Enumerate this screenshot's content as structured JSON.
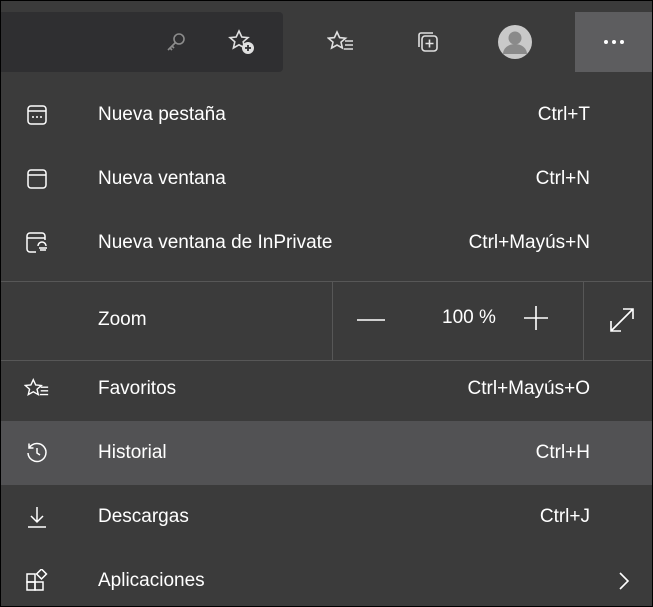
{
  "toolbar": {
    "icons": [
      "key-icon",
      "add-favorite-icon",
      "favorites-icon",
      "collections-icon",
      "profile-avatar",
      "more-icon"
    ]
  },
  "menu": {
    "items": [
      {
        "label": "Nueva pestaña",
        "shortcut": "Ctrl+T",
        "icon": "new-tab-icon"
      },
      {
        "label": "Nueva ventana",
        "shortcut": "Ctrl+N",
        "icon": "new-window-icon"
      },
      {
        "label": "Nueva ventana de InPrivate",
        "shortcut": "Ctrl+Mayús+N",
        "icon": "inprivate-icon"
      }
    ],
    "zoom": {
      "label": "Zoom",
      "value": "100 %"
    },
    "items2": [
      {
        "label": "Favoritos",
        "shortcut": "Ctrl+Mayús+O",
        "icon": "favorites-icon"
      },
      {
        "label": "Historial",
        "shortcut": "Ctrl+H",
        "icon": "history-icon"
      },
      {
        "label": "Descargas",
        "shortcut": "Ctrl+J",
        "icon": "download-icon"
      },
      {
        "label": "Aplicaciones",
        "shortcut": "",
        "icon": "apps-icon"
      }
    ]
  },
  "colors": {
    "background": "#3b3b3b",
    "highlight": "#525254",
    "text": "#ffffff"
  }
}
